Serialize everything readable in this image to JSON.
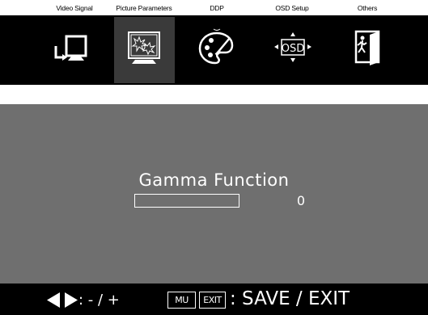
{
  "tabs": [
    {
      "label": "Video Signal",
      "icon": "video-signal-icon"
    },
    {
      "label": "Picture Parameters",
      "icon": "picture-parameters-icon"
    },
    {
      "label": "DDP",
      "icon": "palette-icon"
    },
    {
      "label": "OSD Setup",
      "icon": "osd-setup-icon"
    },
    {
      "label": "Others",
      "icon": "exit-door-icon"
    }
  ],
  "selected_tab": "Picture Parameters",
  "osd_icon_text": "OSD",
  "setting": {
    "title": "Gamma Function",
    "value": "0",
    "level": 0
  },
  "footer": {
    "adjust_hint": ": - / +",
    "menu_key": "MU",
    "exit_key": "EXIT",
    "save_exit_hint": ": SAVE / EXIT"
  },
  "colors": {
    "panel_background": "#6f6f6f",
    "menu_background": "#000000",
    "selected_tab_background": "#3a3a3a",
    "text": "#ffffff"
  }
}
